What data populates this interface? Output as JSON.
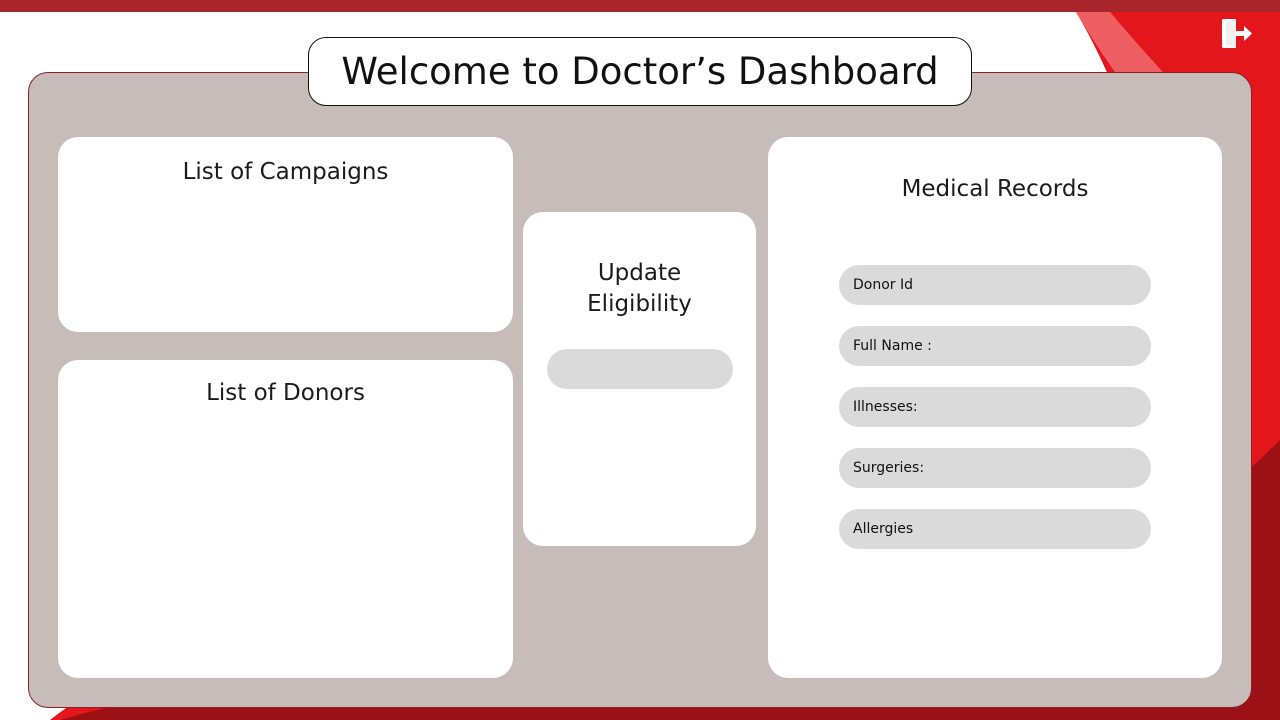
{
  "header": {
    "title": "Welcome to Doctor’s Dashboard",
    "logout_icon": "logout-icon"
  },
  "campaigns": {
    "title": "List of Campaigns"
  },
  "donors": {
    "title": "List of Donors"
  },
  "eligibility": {
    "title_line1": "Update",
    "title_line2": "Eligibility",
    "input_value": ""
  },
  "medical_records": {
    "title": "Medical Records",
    "fields": [
      {
        "label": "Donor Id"
      },
      {
        "label": "Full Name :"
      },
      {
        "label": "Illnesses:"
      },
      {
        "label": "Surgeries:"
      },
      {
        "label": "Allergies"
      }
    ]
  },
  "colors": {
    "brand_red": "#a8262b",
    "accent_red": "#e3161b",
    "panel": "#c6bcba",
    "field": "#dadada"
  }
}
